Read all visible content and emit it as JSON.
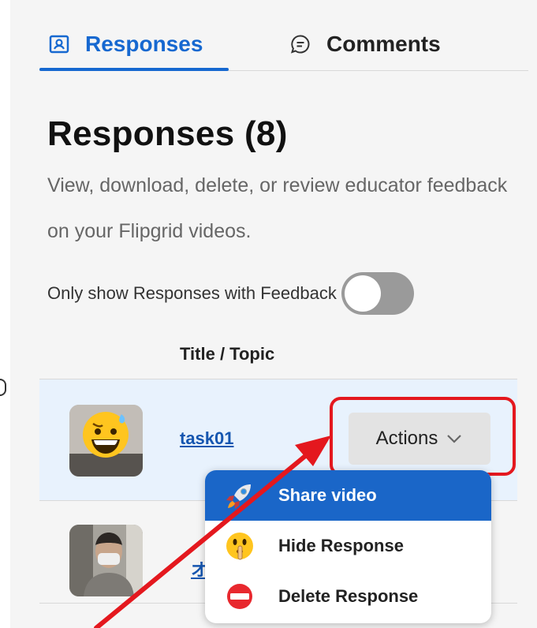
{
  "tabs": [
    {
      "label": "Responses",
      "icon": "responses-icon",
      "active": true
    },
    {
      "label": "Comments",
      "icon": "comments-icon",
      "active": false
    }
  ],
  "page": {
    "title": "Responses (8)",
    "description": "View, download, delete, or review educator feedback on your Flipgrid videos."
  },
  "filter": {
    "label": "Only show Responses with Feedback",
    "enabled": false
  },
  "table": {
    "column_header": "Title / Topic",
    "rows": [
      {
        "title": "task01",
        "actions_label": "Actions"
      },
      {
        "title": "オ"
      }
    ]
  },
  "actions_menu": {
    "items": [
      {
        "label": "Share video",
        "icon": "rocket-icon"
      },
      {
        "label": "Hide Response",
        "icon": "shushing-face-icon"
      },
      {
        "label": "Delete Response",
        "icon": "no-entry-icon"
      }
    ]
  },
  "colors": {
    "accent": "#1668d0",
    "annotation": "#e4181e",
    "selected_row": "#e8f2fd"
  }
}
